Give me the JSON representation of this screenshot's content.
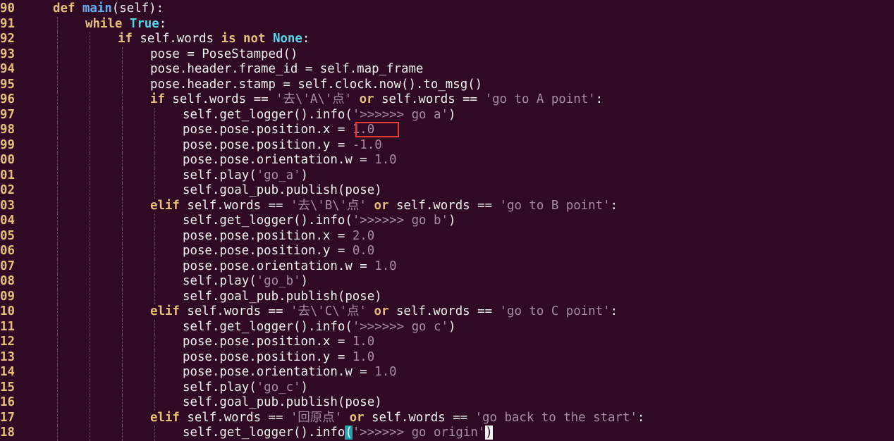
{
  "editor": {
    "lines": [
      {
        "n": "90",
        "indent": 0,
        "html": "<span class=\"kw\">def</span> <span class=\"fn\">main</span>(self):"
      },
      {
        "n": "91",
        "indent": 1,
        "html": "<span class=\"kw\">while</span> <span class=\"const\">True</span>:"
      },
      {
        "n": "92",
        "indent": 2,
        "html": "<span class=\"kw\">if</span> self.words <span class=\"kw\">is</span> <span class=\"kw\">not</span> <span class=\"const\">None</span>:"
      },
      {
        "n": "93",
        "indent": 3,
        "html": "pose = PoseStamped()"
      },
      {
        "n": "94",
        "indent": 3,
        "html": "pose.header.frame_id = self.map_frame"
      },
      {
        "n": "95",
        "indent": 3,
        "html": "pose.header.stamp = self.clock.now().to_msg()"
      },
      {
        "n": "96",
        "indent": 3,
        "html": "<span class=\"kw\">if</span> self.words == <span class=\"str\">'去\\'A\\'点'</span> <span class=\"kw\">or</span> self.words == <span class=\"str\">'go to A point'</span>:"
      },
      {
        "n": "97",
        "indent": 4,
        "html": "self.get_logger().info(<span class=\"str\">'&gt;&gt;&gt;&gt;&gt;&gt; go a'</span>)"
      },
      {
        "n": "98",
        "indent": 4,
        "html": "pose.pose.position.x = <span class=\"num\">1.0</span>"
      },
      {
        "n": "99",
        "indent": 4,
        "html": "pose.pose.position.y = <span class=\"num\">-1.0</span>"
      },
      {
        "n": "00",
        "indent": 4,
        "html": "pose.pose.orientation.w = <span class=\"num\">1.0</span>"
      },
      {
        "n": "01",
        "indent": 4,
        "html": "self.play(<span class=\"str\">'go_a'</span>)"
      },
      {
        "n": "02",
        "indent": 4,
        "html": "self.goal_pub.publish(pose)"
      },
      {
        "n": "03",
        "indent": 3,
        "html": "<span class=\"kw\">elif</span> self.words == <span class=\"str\">'去\\'B\\'点'</span> <span class=\"kw\">or</span> self.words == <span class=\"str\">'go to B point'</span>:"
      },
      {
        "n": "04",
        "indent": 4,
        "html": "self.get_logger().info(<span class=\"str\">'&gt;&gt;&gt;&gt;&gt;&gt; go b'</span>)"
      },
      {
        "n": "05",
        "indent": 4,
        "html": "pose.pose.position.x = <span class=\"num\">2.0</span>"
      },
      {
        "n": "06",
        "indent": 4,
        "html": "pose.pose.position.y = <span class=\"num\">0.0</span>"
      },
      {
        "n": "07",
        "indent": 4,
        "html": "pose.pose.orientation.w = <span class=\"num\">1.0</span>"
      },
      {
        "n": "08",
        "indent": 4,
        "html": "self.play(<span class=\"str\">'go_b'</span>)"
      },
      {
        "n": "09",
        "indent": 4,
        "html": "self.goal_pub.publish(pose)"
      },
      {
        "n": "10",
        "indent": 3,
        "html": "<span class=\"kw\">elif</span> self.words == <span class=\"str\">'去\\'C\\'点'</span> <span class=\"kw\">or</span> self.words == <span class=\"str\">'go to C point'</span>:"
      },
      {
        "n": "11",
        "indent": 4,
        "html": "self.get_logger().info(<span class=\"str\">'&gt;&gt;&gt;&gt;&gt;&gt; go c'</span>)"
      },
      {
        "n": "12",
        "indent": 4,
        "html": "pose.pose.position.x = <span class=\"num\">1.0</span>"
      },
      {
        "n": "13",
        "indent": 4,
        "html": "pose.pose.position.y = <span class=\"num\">1.0</span>"
      },
      {
        "n": "14",
        "indent": 4,
        "html": "pose.pose.orientation.w = <span class=\"num\">1.0</span>"
      },
      {
        "n": "15",
        "indent": 4,
        "html": "self.play(<span class=\"str\">'go_c'</span>)"
      },
      {
        "n": "16",
        "indent": 4,
        "html": "self.goal_pub.publish(pose)"
      },
      {
        "n": "17",
        "indent": 3,
        "html": "<span class=\"kw\">elif</span> self.words == <span class=\"str\">'回原点'</span> <span class=\"kw\">or</span> self.words == <span class=\"str\">'go back to the start'</span>:"
      },
      {
        "n": "18",
        "indent": 4,
        "html": "self.get_logger().info<span class=\"bracket-hl\">(</span><span class=\"str\">'&gt;&gt;&gt;&gt;&gt;&gt; go origin'</span><span class=\"cursor\">)</span>"
      }
    ]
  },
  "colors": {
    "background": "#300a24",
    "keyword": "#e5c07b",
    "function": "#61afef",
    "constant": "#56d6e8",
    "string": "#a78ba7",
    "highlight_box": "#e53935"
  }
}
